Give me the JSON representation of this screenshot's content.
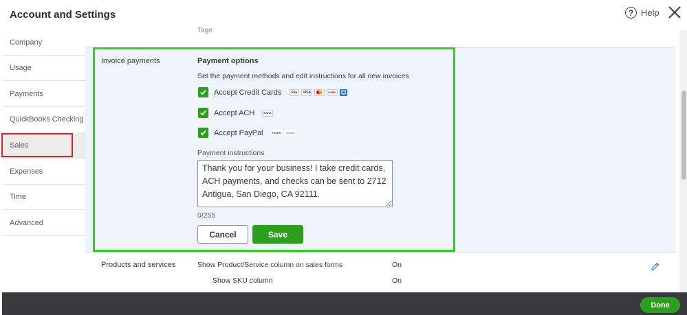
{
  "header": {
    "title": "Account and Settings",
    "help_label": "Help"
  },
  "sidebar": {
    "items": [
      {
        "label": "Company"
      },
      {
        "label": "Usage"
      },
      {
        "label": "Payments"
      },
      {
        "label": "QuickBooks Checking"
      },
      {
        "label": "Sales"
      },
      {
        "label": "Expenses"
      },
      {
        "label": "Time"
      },
      {
        "label": "Advanced"
      }
    ],
    "active": "Sales"
  },
  "content": {
    "cut_text": "Tage",
    "invoice_payments": {
      "section_label": "Invoice payments",
      "title": "Payment options",
      "description": "Set the payment methods and edit instructions for all new invoices",
      "options": [
        {
          "label": "Accept Credit Cards",
          "checked": true,
          "icons": [
            "Pay",
            "VISA",
            "",
            "",
            ""
          ]
        },
        {
          "label": "Accept ACH",
          "checked": true,
          "icons": [
            "BANK"
          ]
        },
        {
          "label": "Accept PayPal",
          "checked": true,
          "icons": [
            "PayPal",
            "venmo"
          ]
        }
      ],
      "instructions_label": "Payment instructions",
      "instructions_text": "Thank you for your business! I take credit cards, ACH payments, and checks can be sent to 2712 Antigua, San Diego, CA 92111.",
      "char_count": "0/255",
      "cancel_label": "Cancel",
      "save_label": "Save"
    },
    "products_services": {
      "section_label": "Products and services",
      "rows": [
        {
          "label": "Show Product/Service column on sales forms",
          "value": "On"
        },
        {
          "label": "Show SKU column",
          "value": "On"
        }
      ]
    }
  },
  "footer": {
    "done_label": "Done"
  },
  "colors": {
    "accent_green": "#2ca01c",
    "highlight_green": "#2cd218",
    "highlight_red": "#e0202a",
    "footer": "#393a3d"
  }
}
